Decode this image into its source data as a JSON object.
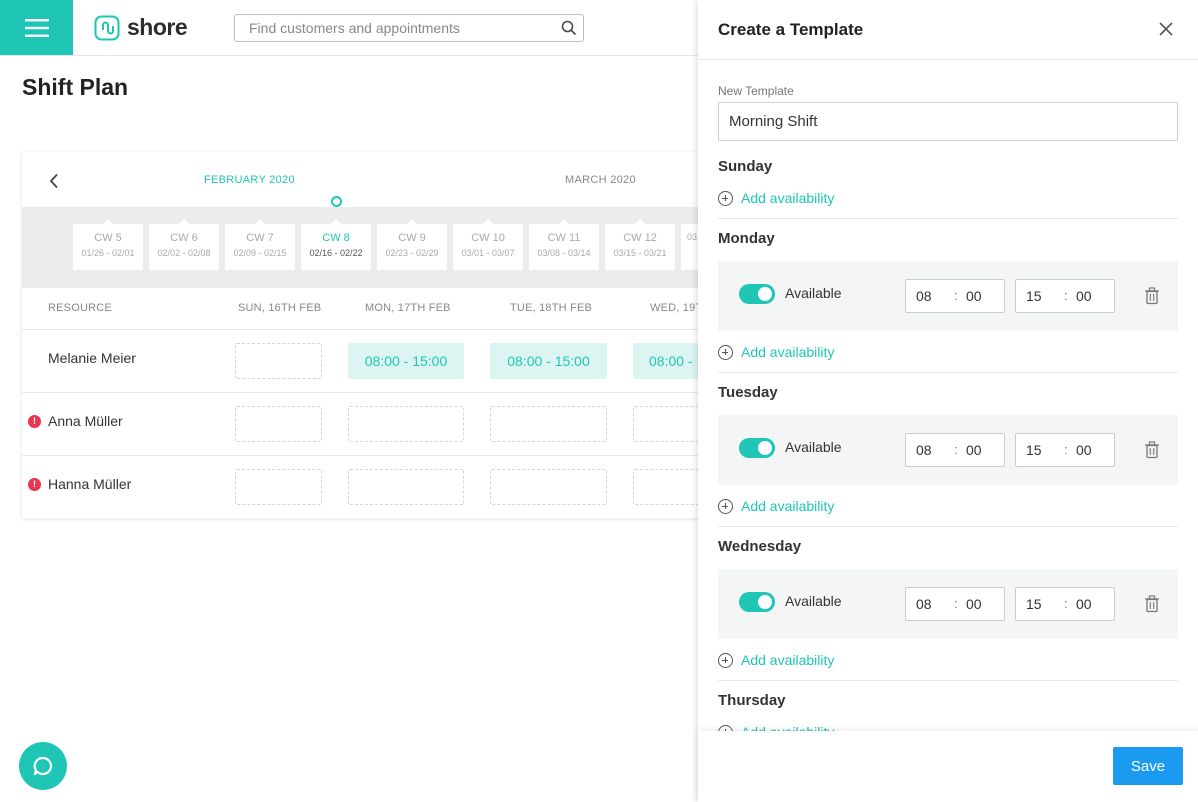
{
  "app": {
    "brand": "shore",
    "search_placeholder": "Find customers and appointments",
    "page_title": "Shift Plan"
  },
  "calendar": {
    "months": [
      "FEBRUARY 2020",
      "MARCH 2020"
    ],
    "weeks": [
      {
        "cw": "CW 5",
        "dates": "01/26 - 02/01"
      },
      {
        "cw": "CW 6",
        "dates": "02/02 - 02/08"
      },
      {
        "cw": "CW 7",
        "dates": "02/09 - 02/15"
      },
      {
        "cw": "CW 8",
        "dates": "02/16 - 02/22",
        "active": true
      },
      {
        "cw": "CW 9",
        "dates": "02/23 - 02/29"
      },
      {
        "cw": "CW 10",
        "dates": "03/01 - 03/07"
      },
      {
        "cw": "CW 11",
        "dates": "03/08 - 03/14"
      },
      {
        "cw": "CW 12",
        "dates": "03/15 - 03/21"
      },
      {
        "cw": "",
        "dates": "03"
      }
    ],
    "columns": [
      "RESOURCE",
      "SUN, 16TH FEB",
      "MON, 17TH FEB",
      "TUE, 18TH FEB",
      "WED, 19T"
    ],
    "rows": [
      {
        "name": "Melanie Meier",
        "warning": false,
        "slots": [
          "",
          "08:00 - 15:00",
          "08:00 - 15:00",
          "08:00 - "
        ]
      },
      {
        "name": "Anna Müller",
        "warning": true,
        "slots": [
          "",
          "",
          "",
          ""
        ]
      },
      {
        "name": "Hanna Müller",
        "warning": true,
        "slots": [
          "",
          "",
          "",
          ""
        ]
      }
    ]
  },
  "panel": {
    "title": "Create a Template",
    "name_label": "New Template",
    "name_value": "Morning Shift",
    "add_availability": "Add availability",
    "available_label": "Available",
    "time_separator": ":",
    "days": [
      {
        "name": "Sunday",
        "slots": []
      },
      {
        "name": "Monday",
        "slots": [
          {
            "from_h": "08",
            "from_m": "00",
            "to_h": "15",
            "to_m": "00"
          }
        ]
      },
      {
        "name": "Tuesday",
        "slots": [
          {
            "from_h": "08",
            "from_m": "00",
            "to_h": "15",
            "to_m": "00"
          }
        ]
      },
      {
        "name": "Wednesday",
        "slots": [
          {
            "from_h": "08",
            "from_m": "00",
            "to_h": "15",
            "to_m": "00"
          }
        ]
      },
      {
        "name": "Thursday",
        "slots": []
      }
    ],
    "save_label": "Save"
  },
  "colors": {
    "accent": "#1fc6b6",
    "save": "#1a9bf0",
    "warning": "#e8364f"
  }
}
